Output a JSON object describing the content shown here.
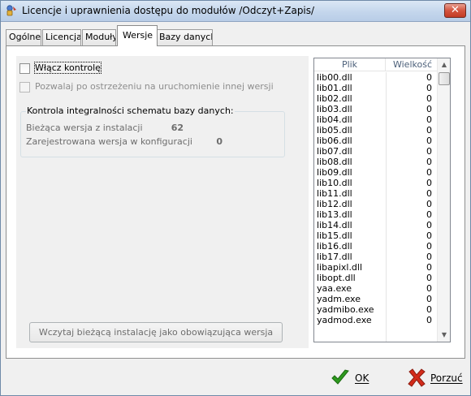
{
  "window": {
    "title": "Licencje i uprawnienia dostępu do modułów /Odczyt+Zapis/",
    "close_glyph": "✕"
  },
  "tabs": [
    {
      "label": "Ogólne"
    },
    {
      "label": "Licencja"
    },
    {
      "label": "Moduły"
    },
    {
      "label": "Wersje"
    },
    {
      "label": "Bazy danych"
    }
  ],
  "active_tab": "Wersje",
  "options": {
    "enable_control": {
      "label": "Włącz kontrolę",
      "checked": false
    },
    "allow_after_warning": {
      "label": "Pozwalaj po ostrzeżeniu na uruchomienie innej wersji",
      "checked": false,
      "disabled": true
    }
  },
  "integrity_group": {
    "title": "Kontrola integralności schematu bazy danych:",
    "current_label": "Bieżąca wersja z instalacji",
    "current_value": "62",
    "registered_label": "Zarejestrowana wersja w konfiguracji",
    "registered_value": "0"
  },
  "load_button": "Wczytaj bieżącą instalację jako obowiązująca wersja",
  "file_list": {
    "headers": [
      "Plik",
      "Wielkość"
    ],
    "rows": [
      {
        "name": "lib00.dll",
        "size": "0"
      },
      {
        "name": "lib01.dll",
        "size": "0"
      },
      {
        "name": "lib02.dll",
        "size": "0"
      },
      {
        "name": "lib03.dll",
        "size": "0"
      },
      {
        "name": "lib04.dll",
        "size": "0"
      },
      {
        "name": "lib05.dll",
        "size": "0"
      },
      {
        "name": "lib06.dll",
        "size": "0"
      },
      {
        "name": "lib07.dll",
        "size": "0"
      },
      {
        "name": "lib08.dll",
        "size": "0"
      },
      {
        "name": "lib09.dll",
        "size": "0"
      },
      {
        "name": "lib10.dll",
        "size": "0"
      },
      {
        "name": "lib11.dll",
        "size": "0"
      },
      {
        "name": "lib12.dll",
        "size": "0"
      },
      {
        "name": "lib13.dll",
        "size": "0"
      },
      {
        "name": "lib14.dll",
        "size": "0"
      },
      {
        "name": "lib15.dll",
        "size": "0"
      },
      {
        "name": "lib16.dll",
        "size": "0"
      },
      {
        "name": "lib17.dll",
        "size": "0"
      },
      {
        "name": "libapixl.dll",
        "size": "0"
      },
      {
        "name": "libopt.dll",
        "size": "0"
      },
      {
        "name": "yaa.exe",
        "size": "0"
      },
      {
        "name": "yadm.exe",
        "size": "0"
      },
      {
        "name": "yadmibo.exe",
        "size": "0"
      },
      {
        "name": "yadmod.exe",
        "size": "0"
      }
    ]
  },
  "footer": {
    "ok_label": "OK",
    "cancel_label": "Porzuć",
    "ok_color": "#2e9a1f",
    "cancel_color": "#d32b1a"
  }
}
